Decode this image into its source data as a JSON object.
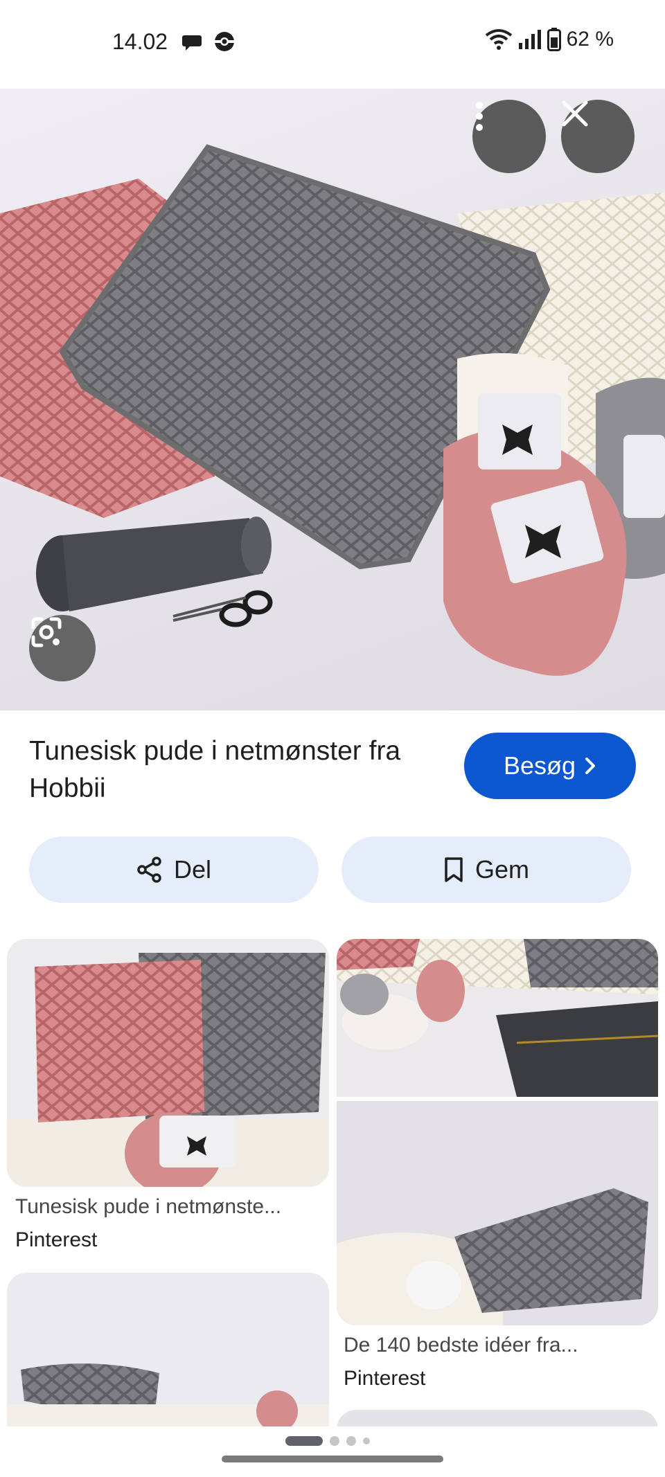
{
  "status_bar": {
    "time": "14.02",
    "left_icons": [
      "chat-bubble-icon",
      "pokeball-icon"
    ],
    "battery": "62 %",
    "right_icons": [
      "wifi-icon",
      "signal-icon",
      "battery-icon"
    ]
  },
  "hero": {
    "description_icons": [
      "more-vert-icon",
      "close-icon",
      "lens-icon"
    ]
  },
  "result": {
    "title": "Tunesisk pude i netmønster fra Hobbii",
    "visit_label": "Besøg",
    "share_label": "Del",
    "save_label": "Gem"
  },
  "related": [
    {
      "title": "Tunesisk pude i netmønste...",
      "source": "Pinterest"
    },
    {
      "title": "De 140 bedste idéer fra...",
      "source": "Pinterest"
    }
  ],
  "colors": {
    "accent": "#0b57d0",
    "tonal_button": "#e5edfa",
    "pillow_gray": "#7d7d80",
    "pillow_pink": "#d8878a"
  }
}
